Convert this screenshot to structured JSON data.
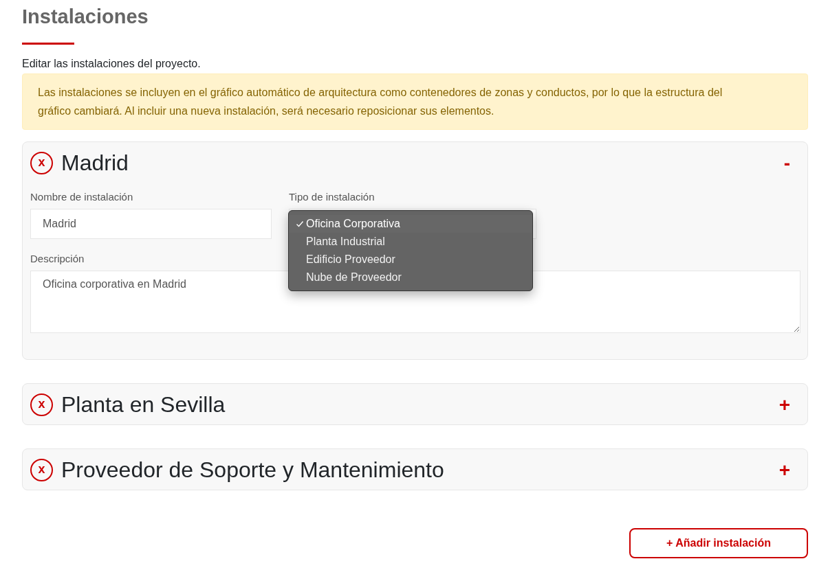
{
  "page": {
    "title": "Instalaciones",
    "subtitle": "Editar las instalaciones del proyecto.",
    "alert": "Las instalaciones se incluyen en el gráfico automático de arquitectura como contenedores de zonas y conductos, por lo que la estructura del gráfico cambiará. Al incluir una nueva instalación, será necesario reposicionar sus elementos."
  },
  "facilities": [
    {
      "name": "Madrid",
      "remove": "x",
      "toggle": "-",
      "expanded": true,
      "name_label": "Nombre de instalación",
      "name_value": "Madrid",
      "type_label": "Tipo de instalación",
      "description_label": "Descripción",
      "description_value": "Oficina corporativa en Madrid",
      "type_menu": [
        {
          "label": "Oficina Corporativa",
          "selected": true
        },
        {
          "label": "Planta Industrial",
          "selected": false
        },
        {
          "label": "Edificio Proveedor",
          "selected": false
        },
        {
          "label": "Nube de Proveedor",
          "selected": false
        }
      ]
    },
    {
      "name": "Planta en Sevilla",
      "remove": "x",
      "toggle": "+",
      "expanded": false
    },
    {
      "name": "Proveedor de Soporte y Mantenimiento",
      "remove": "x",
      "toggle": "+",
      "expanded": false
    }
  ],
  "add_button": "+ Añadir instalación"
}
